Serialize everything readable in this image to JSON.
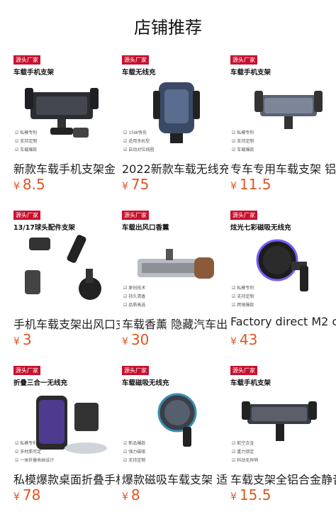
{
  "page": {
    "title": "店铺推荐"
  },
  "currency": "¥",
  "products": [
    {
      "tag": "源头厂家",
      "subtitle": "车载手机支架",
      "name": "新款车载手机支架金",
      "price": "8.5",
      "features": [
        "私模专利",
        "支持定制",
        "车载爆款"
      ]
    },
    {
      "tag": "源头厂家",
      "subtitle": "车载无线充",
      "name": "2022新款车载无线充",
      "price": "75",
      "features": [
        "15W快充",
        "适用多机型",
        "自动对位线圈"
      ]
    },
    {
      "tag": "源头厂家",
      "subtitle": "车载手机支架",
      "name": "专车专用车载支架 铝",
      "price": "11.5",
      "features": [
        "私模专利",
        "支持定制",
        "车载爆款"
      ]
    },
    {
      "tag": "源头厂家",
      "subtitle": "13/17球头配件支架",
      "name": "手机车载支架出风口支",
      "price": "3",
      "features": []
    },
    {
      "tag": "源头厂家",
      "subtitle": "车载出风口香薰",
      "name": "车载香薰 隐藏汽车出",
      "price": "30",
      "features": [
        "原创技术",
        "持久清香",
        "品质高选"
      ]
    },
    {
      "tag": "源头厂家",
      "subtitle": "炫光七彩磁吸无线充",
      "name": "Factory direct M2 c",
      "price": "43",
      "features": [
        "私模专利",
        "支持定制",
        "跨境爆款"
      ]
    },
    {
      "tag": "源头厂家",
      "subtitle": "折叠三合一无线充",
      "name": "私模爆款桌面折叠手机",
      "price": "78",
      "features": [
        "私模专利",
        "多材质可定",
        "一体折叠收纳设计"
      ]
    },
    {
      "tag": "源头厂家",
      "subtitle": "车载磁吸无线充",
      "name": "爆款磁吸车载支架 适",
      "price": "8",
      "features": [
        "新品爆款",
        "强力磁吸",
        "支持定制"
      ]
    },
    {
      "tag": "源头厂家",
      "subtitle": "车载手机支架",
      "name": "车载支架全铝合金静音",
      "price": "15.5",
      "features": [
        "航空合金",
        "重力锁定",
        "科动无异响"
      ]
    }
  ]
}
